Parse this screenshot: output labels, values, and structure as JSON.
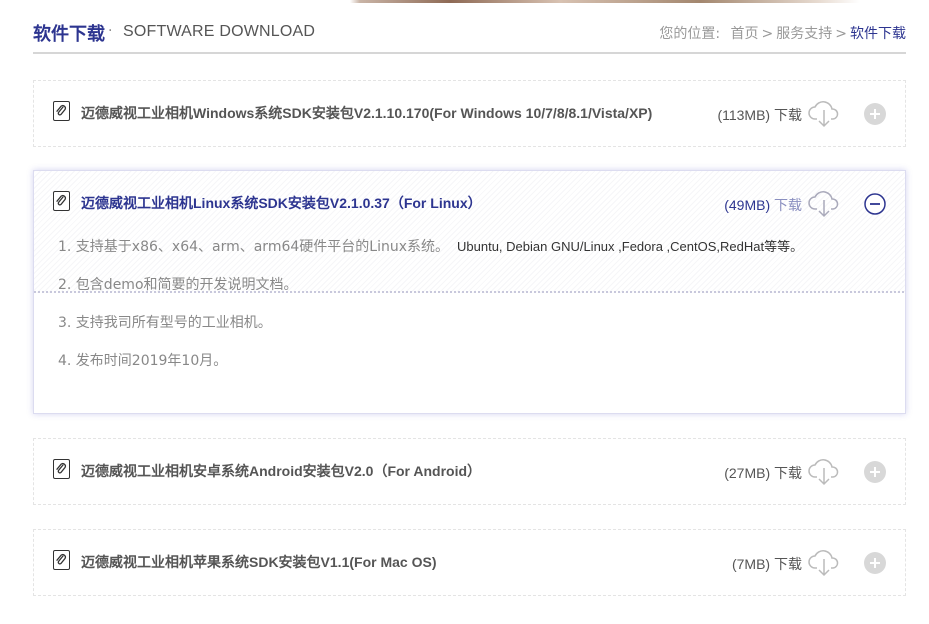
{
  "header": {
    "title_cn": "软件下载",
    "title_dot": "·",
    "title_en": "SOFTWARE DOWNLOAD",
    "breadcrumb": {
      "prefix": "您的位置:",
      "items": [
        "首页",
        "服务支持",
        "软件下载"
      ],
      "separator": ">"
    }
  },
  "colors": {
    "accent": "#2d3590",
    "text": "#666666",
    "muted": "#999999"
  },
  "downloads": [
    {
      "name": "迈德威视工业相机Windows系统SDK安装包V2.1.10.170(For Windows 10/7/8/8.1/Vista/XP)",
      "size": "(113MB)",
      "download_label": "下载",
      "expanded": false,
      "toggle_icon": "plus-circle-icon"
    },
    {
      "name": "迈德威视工业相机Linux系统SDK安装包V2.1.0.37（For Linux）",
      "size": "(49MB)",
      "download_label": "下载",
      "expanded": true,
      "toggle_icon": "minus-circle-icon",
      "details": [
        {
          "text": "1. 支持基于x86、x64、arm、arm64硬件平台的Linux系统。",
          "extra": "Ubuntu, Debian GNU/Linux ,Fedora ,CentOS,RedHat等等。"
        },
        {
          "text": "2. 包含demo和简要的开发说明文档。",
          "extra": ""
        },
        {
          "text": "3. 支持我司所有型号的工业相机。",
          "extra": ""
        },
        {
          "text": "4. 发布时间2019年10月。",
          "extra": ""
        }
      ]
    },
    {
      "name": "迈德威视工业相机安卓系统Android安装包V2.0（For Android）",
      "size": "(27MB)",
      "download_label": "下载",
      "expanded": false,
      "toggle_icon": "plus-circle-icon"
    },
    {
      "name": "迈德威视工业相机苹果系统SDK安装包V1.1(For Mac OS)",
      "size": "(7MB)",
      "download_label": "下载",
      "expanded": false,
      "toggle_icon": "plus-circle-icon"
    }
  ]
}
